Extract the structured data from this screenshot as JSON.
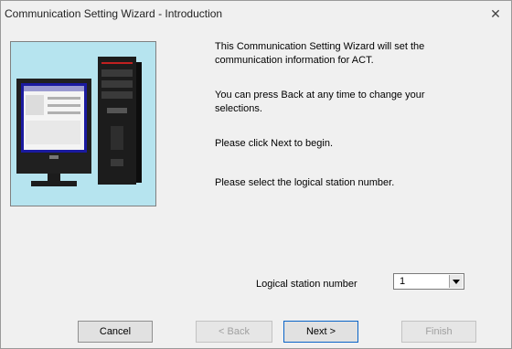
{
  "window": {
    "title": "Communication Setting Wizard - Introduction",
    "close_glyph": "✕"
  },
  "illustration": {
    "icon": "computer-workstation-illustration",
    "colors": {
      "background": "#b6e4ef",
      "monitor_body": "#1f1f1f",
      "screen_border": "#1a1aa0",
      "screen": "#ffffff"
    }
  },
  "intro": {
    "line1a": "This Communication Setting Wizard will set the",
    "line1b": "communication information for ACT.",
    "line2a": "You can press Back at any time to change your",
    "line2b": "selections.",
    "line3": "Please click Next to begin.",
    "line4": "Please select the logical station number."
  },
  "station": {
    "label": "Logical station number",
    "selected": "1",
    "arrow_icon": "dropdown-arrow"
  },
  "buttons": {
    "cancel": "Cancel",
    "back": "< Back",
    "next": "Next >",
    "finish": "Finish"
  }
}
